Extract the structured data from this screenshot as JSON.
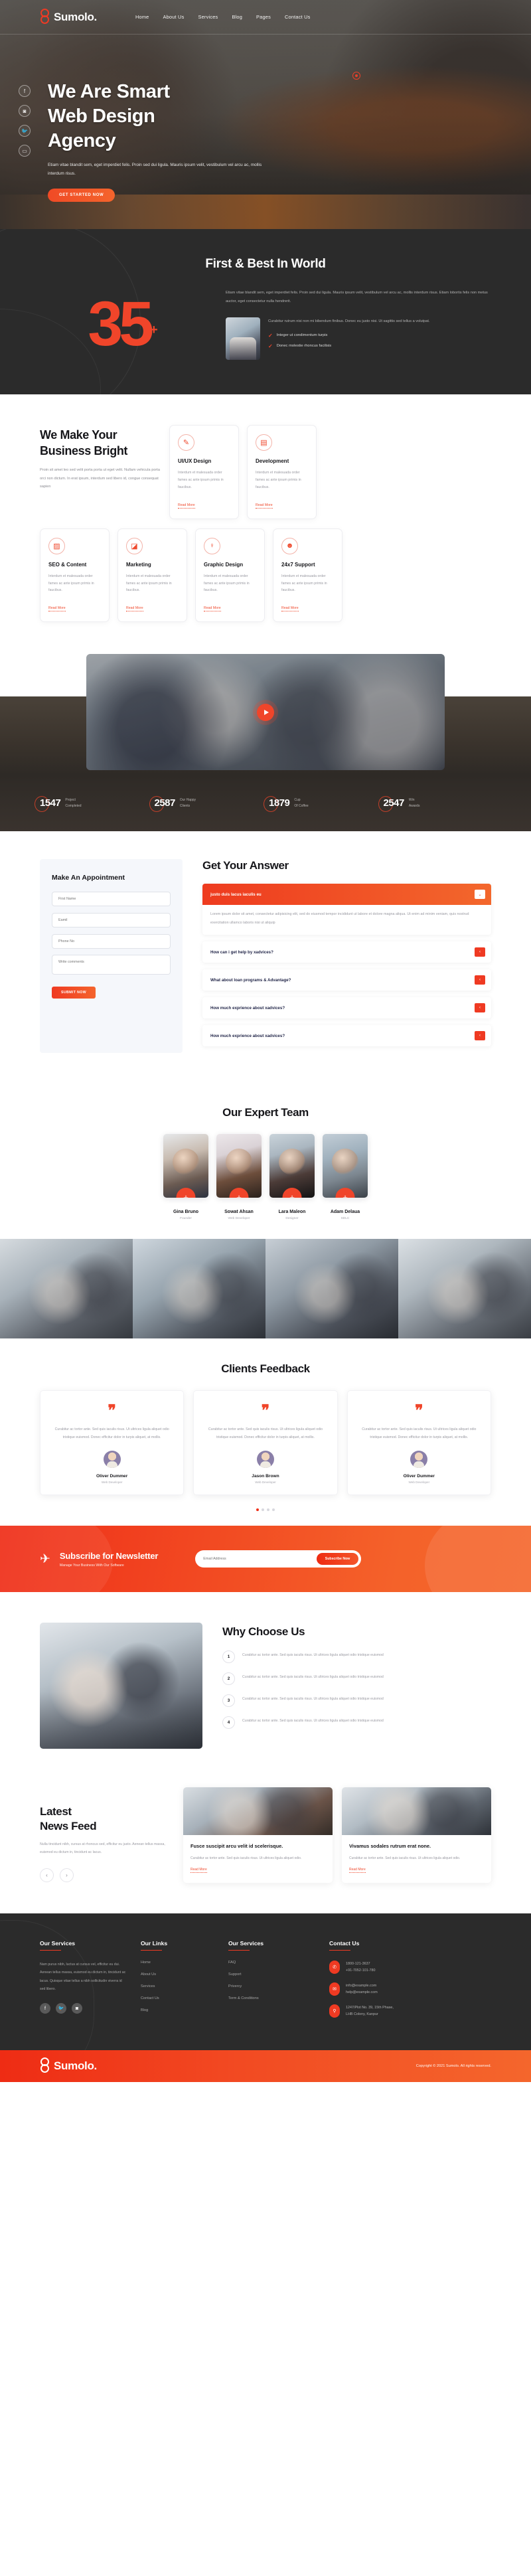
{
  "brand": {
    "name": "Sumolo.",
    "mark_icon": "chain-links-icon"
  },
  "nav": {
    "items": [
      {
        "label": "Home"
      },
      {
        "label": "About Us"
      },
      {
        "label": "Services"
      },
      {
        "label": "Blog"
      },
      {
        "label": "Pages"
      },
      {
        "label": "Contact Us"
      }
    ]
  },
  "hero": {
    "title_line1": "We Are Smart",
    "title_line2": "Web Design",
    "title_line3": "Agency",
    "description": "Etiam vitae blandit sem, eget imperdiet felis. Proin sed dui ligula. Mauris ipsum velit, vestibulum vel arcu ac, mollis interdum risus.",
    "cta": "GET STARTED NOW",
    "socials": [
      {
        "name": "facebook-icon",
        "glyph": "f"
      },
      {
        "name": "instagram-icon",
        "glyph": "◙"
      },
      {
        "name": "twitter-icon",
        "glyph": "🐦"
      },
      {
        "name": "youtube-icon",
        "glyph": "▭"
      }
    ]
  },
  "stats": {
    "title": "First & Best In World",
    "number": "35",
    "plus": "+",
    "paragraph": "Etiam vitae blandit sem, eget imperdiet felis. Proin sed dui ligula. Mauris ipsum velit, vestibulum vel arcu ac, mollis interdum risus. Etiam lobortis felis non metus auctor, eget consectetur nulla hendrerit.",
    "card_paragraph": "Curabitur rutrum nisi non mi bibendum finibus. Donec eu justo nisi. Ut sagittis sed tellus a volutpat.",
    "checks": [
      {
        "label": "Integer ut condimentum turpis"
      },
      {
        "label": "Donec molestie rhoncus facilisis"
      }
    ]
  },
  "services": {
    "heading_line1": "We Make Your",
    "heading_line2": "Business Bright",
    "subtext": "Proin sit amet leo sed velit porta porta ut eget velit. Nullam vehicula porta orci non dictum. In erat ipsum, interdum sed libero id, congue consequat sapien",
    "read_more": "Read More",
    "body": "Interdum et malesuada order fames ac ante ipsum primis in faucibus.",
    "cards": [
      {
        "title": "UI/UX Design",
        "icon": "ui-design-icon",
        "glyph": "✎"
      },
      {
        "title": "Development",
        "icon": "code-window-icon",
        "glyph": "▤"
      },
      {
        "title": "SEO & Content",
        "icon": "seo-chart-icon",
        "glyph": "▨"
      },
      {
        "title": "Marketing",
        "icon": "marketing-megaphone-icon",
        "glyph": "◪"
      },
      {
        "title": "Graphic Design",
        "icon": "lightbulb-icon",
        "glyph": "♀"
      },
      {
        "title": "24x7 Support",
        "icon": "support-agent-icon",
        "glyph": "☻"
      }
    ]
  },
  "video": {
    "play_icon": "play-icon"
  },
  "counters": [
    {
      "value": "1547",
      "label_line1": "Project",
      "label_line2": "Completed"
    },
    {
      "value": "2587",
      "label_line1": "Our Happy",
      "label_line2": "Clients"
    },
    {
      "value": "1879",
      "label_line1": "Cup",
      "label_line2": "Of Coffee"
    },
    {
      "value": "2547",
      "label_line1": "Win",
      "label_line2": "Awards"
    }
  ],
  "appointment": {
    "title": "Make An Appointment",
    "fields": [
      {
        "name": "first-name-field",
        "placeholder": "First Name"
      },
      {
        "name": "email-field",
        "placeholder": "Eamil"
      },
      {
        "name": "phone-field",
        "placeholder": "Phone No"
      }
    ],
    "comment_placeholder": "Write comments",
    "submit": "SUBMIT NOW"
  },
  "faq": {
    "title": "Get Your Answer",
    "items": [
      {
        "question": "justo duis lacus iaculis eu",
        "answer": "Lorem ipsum dolor sit amet, consectetur adipisicing elit, sed do eiusmod tempor incididunt ut labore et dolore magna aliqua. Ut enim ad minim veniam, quis nostrud exercitation ullamco laboris nisi ut aliquip",
        "open": true,
        "toggle": "⌄"
      },
      {
        "question": "How can i get help by xadvices?",
        "open": false,
        "toggle": "‹"
      },
      {
        "question": "What about loan programs & Advantage?",
        "open": false,
        "toggle": "‹"
      },
      {
        "question": "How much exprience about xadvices?",
        "open": false,
        "toggle": "‹"
      },
      {
        "question": "How much exprience about xadvices?",
        "open": false,
        "toggle": "‹"
      }
    ]
  },
  "team": {
    "title": "Our Expert Team",
    "members": [
      {
        "name": "Gina Bruno",
        "role": "Founder"
      },
      {
        "name": "Sowat Ahsan",
        "role": "Web Developer"
      },
      {
        "name": "Lara Maleon",
        "role": "Designer"
      },
      {
        "name": "Adam Delaua",
        "role": "SDLC"
      }
    ]
  },
  "testimonials": {
    "title": "Clients Feedback",
    "quote_glyph": "❞",
    "items": [
      {
        "text": "Curabitur ac tortor ante. Sed quis iaculis risus. Ut ultrices ligula aliquet odio tristique euismod. Donec efficitur dolor in turpis aliquet, at mollis.",
        "name": "Oliver Dummer",
        "role": "Web Developer"
      },
      {
        "text": "Curabitur ac tortor ante. Sed quis iaculis risus. Ut ultrices ligula aliquet odio tristique euismod. Donec efficitur dolor in turpis aliquet, at mollis.",
        "name": "Jason Brown",
        "role": "Web Developer"
      },
      {
        "text": "Curabitur ac tortor ante. Sed quis iaculis risus. Ut ultrices ligula aliquet odio tristique euismod. Donec efficitur dolor in turpis aliquet, at mollis.",
        "name": "Oliver Dummer",
        "role": "Web Developer"
      }
    ],
    "dots": 4,
    "active_dot": 0
  },
  "newsletter": {
    "icon": "paper-plane-icon",
    "title": "Subscribe for Newsletter",
    "subtitle": "Manage Your Business With Our Software",
    "placeholder": "Email Address",
    "button": "Subscribe Now"
  },
  "why": {
    "title": "Why Choose Us",
    "items": [
      {
        "num": "1",
        "text": "Curabitur ac tortor ante. Sed quis iaculis risus. Ut ultrices ligula aliquet odio tristique euismod"
      },
      {
        "num": "2",
        "text": "Curabitur ac tortor ante. Sed quis iaculis risus. Ut ultrices ligula aliquet odio tristique euismod"
      },
      {
        "num": "3",
        "text": "Curabitur ac tortor ante. Sed quis iaculis risus. Ut ultrices ligula aliquet odio tristique euismod"
      },
      {
        "num": "4",
        "text": "Curabitur ac tortor ante. Sed quis iaculis risus. Ut ultrices ligula aliquet odio tristique euismod"
      }
    ]
  },
  "feed": {
    "title_line1": "Latest",
    "title_line2": "News Feed",
    "subtext": "Nulla tincidunt nibh, cursus at rhoncus sed, efficitur eu justo. Aenean tellus massa, euismod eu dictum in, tincidunt ac lacus.",
    "prev": "‹",
    "next": "›",
    "read_more": "Read More",
    "cards": [
      {
        "title": "Fusce suscipit arcu velit id scelerisque.",
        "text": "Curabitur ac tortor ante. Sed quis iaculis risus. Ut ultrices ligula aliquet odio."
      },
      {
        "title": "Vivamus sodales rutrum erat none.",
        "text": "Curabitur ac tortor ante. Sed quis iaculis risus. Ut ultrices ligula aliquet odio."
      }
    ]
  },
  "footer": {
    "col1": {
      "heading": "Our Services",
      "text": "Nam purus nibh, luctus at cursus vel, efficitur eu dui. Aenean tellus massa, euismod eu dictum in, tincidunt ac lacus. Quisque vitae tellus a nibh sollicitudin viverra id sed libero.",
      "socials": [
        {
          "name": "facebook-icon",
          "glyph": "f"
        },
        {
          "name": "twitter-icon",
          "glyph": "🐦"
        },
        {
          "name": "instagram-icon",
          "glyph": "◙"
        }
      ]
    },
    "col2": {
      "heading": "Our Links",
      "links": [
        {
          "label": "Home"
        },
        {
          "label": "About Us"
        },
        {
          "label": "Services"
        },
        {
          "label": "Contact Us"
        },
        {
          "label": "Blog"
        }
      ]
    },
    "col3": {
      "heading": "Our Services",
      "links": [
        {
          "label": "FAQ"
        },
        {
          "label": "Support"
        },
        {
          "label": "Privercy"
        },
        {
          "label": "Term & Conditions"
        }
      ]
    },
    "col4": {
      "heading": "Contact Us",
      "groups": [
        {
          "icon": "phone-icon",
          "glyph": "✆",
          "lines": [
            "1800-121-3637",
            "+91-7052-101-780"
          ]
        },
        {
          "icon": "mail-icon",
          "glyph": "✉",
          "lines": [
            "info@example.com",
            "help@example.com"
          ]
        },
        {
          "icon": "location-pin-icon",
          "glyph": "⚲",
          "lines": [
            "1247/Plot No. 39, 15th Phase,",
            "LHB Colony, Kanpur"
          ]
        }
      ]
    },
    "copyright": "Copyright © 2021 Sumolo. All rights reserved."
  },
  "colors": {
    "accent": "#f0452a",
    "accent_dark": "#ee2c14",
    "dark": "#2b2b2b"
  }
}
